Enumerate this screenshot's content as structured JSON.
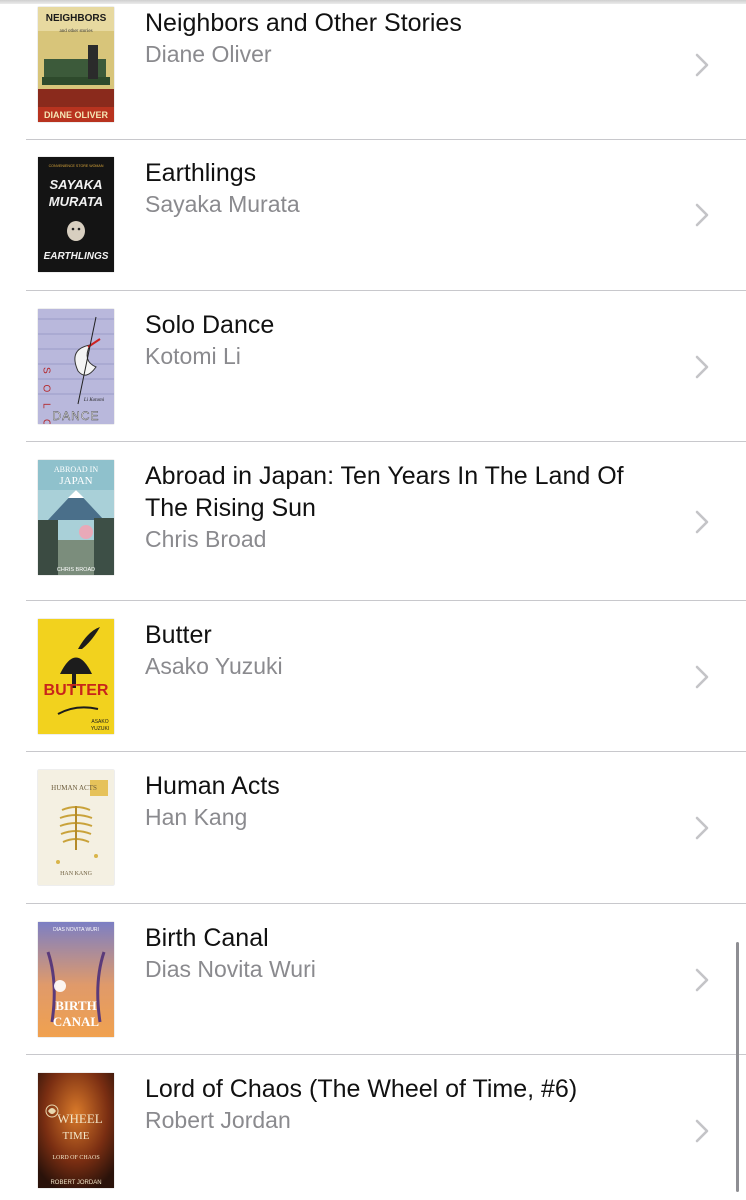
{
  "colors": {
    "separator": "#c8c8cc",
    "author": "#8a8a8e",
    "chevron": "#c4c4c7"
  },
  "books": [
    {
      "title": "Neighbors and Other Stories",
      "author": "Diane Oliver",
      "cover": {
        "lines": [
          "NEIGHBORS",
          "and other stories",
          "DIANE OLIVER"
        ]
      }
    },
    {
      "title": "Earthlings",
      "author": "Sayaka Murata",
      "cover": {
        "lines": [
          "CONVENIENCE STORE WOMAN",
          "SAYAKA",
          "MURATA",
          "EARTHLINGS"
        ]
      }
    },
    {
      "title": "Solo Dance",
      "author": "Kotomi Li",
      "cover": {
        "lines": [
          "S O L O",
          "DANCE",
          "Li Kotomi"
        ]
      }
    },
    {
      "title": "Abroad in Japan: Ten Years In The Land Of The Rising Sun",
      "author": "Chris Broad",
      "cover": {
        "lines": [
          "ABROAD IN",
          "JAPAN",
          "CHRIS BROAD"
        ]
      }
    },
    {
      "title": "Butter",
      "author": "Asako Yuzuki",
      "cover": {
        "lines": [
          "BUTTER",
          "ASAKO",
          "YUZUKI"
        ]
      }
    },
    {
      "title": "Human Acts",
      "author": "Han Kang",
      "cover": {
        "lines": [
          "HUMAN ACTS",
          "HAN KANG"
        ]
      }
    },
    {
      "title": "Birth Canal",
      "author": "Dias Novita Wuri",
      "cover": {
        "lines": [
          "DIAS NOVITA WURI",
          "BIRTH",
          "CANAL"
        ]
      }
    },
    {
      "title": "Lord of Chaos (The Wheel of Time, #6)",
      "author": "Robert Jordan",
      "cover": {
        "lines": [
          "WHEEL",
          "TIME",
          "LORD OF CHAOS",
          "ROBERT JORDAN"
        ]
      }
    }
  ]
}
